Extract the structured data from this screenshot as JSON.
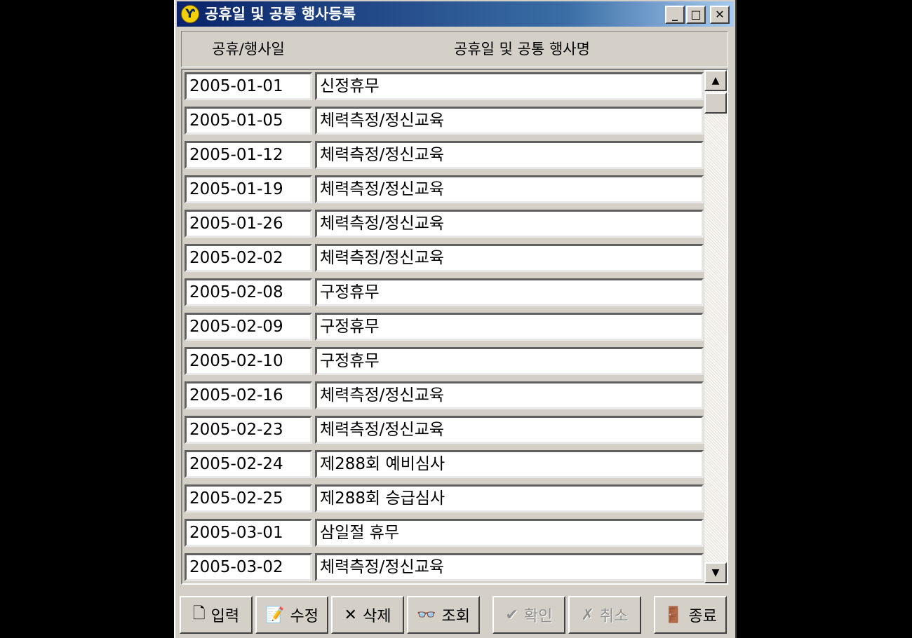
{
  "window": {
    "title": "공휴일 및 공통 행사등록",
    "icon_glyph": "Ƴ",
    "buttons": {
      "minimize": "_",
      "maximize": "□",
      "close": "✕"
    }
  },
  "table": {
    "columns": [
      "공휴/행사일",
      "공휴일 및 공통 행사명"
    ],
    "rows": [
      {
        "date": "2005-01-01",
        "name": "신정휴무"
      },
      {
        "date": "2005-01-05",
        "name": "체력측정/정신교육"
      },
      {
        "date": "2005-01-12",
        "name": "체력측정/정신교육"
      },
      {
        "date": "2005-01-19",
        "name": "체력측정/정신교육"
      },
      {
        "date": "2005-01-26",
        "name": "체력측정/정신교육"
      },
      {
        "date": "2005-02-02",
        "name": "체력측정/정신교육"
      },
      {
        "date": "2005-02-08",
        "name": "구정휴무"
      },
      {
        "date": "2005-02-09",
        "name": "구정휴무"
      },
      {
        "date": "2005-02-10",
        "name": "구정휴무"
      },
      {
        "date": "2005-02-16",
        "name": "체력측정/정신교육"
      },
      {
        "date": "2005-02-23",
        "name": "체력측정/정신교육"
      },
      {
        "date": "2005-02-24",
        "name": "제288회 예비심사"
      },
      {
        "date": "2005-02-25",
        "name": "제288회 승급심사"
      },
      {
        "date": "2005-03-01",
        "name": "삼일절 휴무"
      },
      {
        "date": "2005-03-02",
        "name": "체력측정/정신교육"
      }
    ]
  },
  "toolbar": {
    "buttons": [
      {
        "label": "입력",
        "icon": "new-document-icon",
        "glyph": "🗋",
        "enabled": true
      },
      {
        "label": "수정",
        "icon": "edit-document-icon",
        "glyph": "📝",
        "enabled": true
      },
      {
        "label": "삭제",
        "icon": "delete-x-icon",
        "glyph": "✕",
        "enabled": true
      },
      {
        "label": "조회",
        "icon": "binoculars-icon",
        "glyph": "👓",
        "enabled": true
      },
      {
        "label": "확인",
        "icon": "checkmark-icon",
        "glyph": "✔",
        "enabled": false
      },
      {
        "label": "취소",
        "icon": "cancel-x-icon",
        "glyph": "✗",
        "enabled": false
      },
      {
        "label": "종료",
        "icon": "exit-door-icon",
        "glyph": "🚪",
        "enabled": true
      }
    ]
  }
}
